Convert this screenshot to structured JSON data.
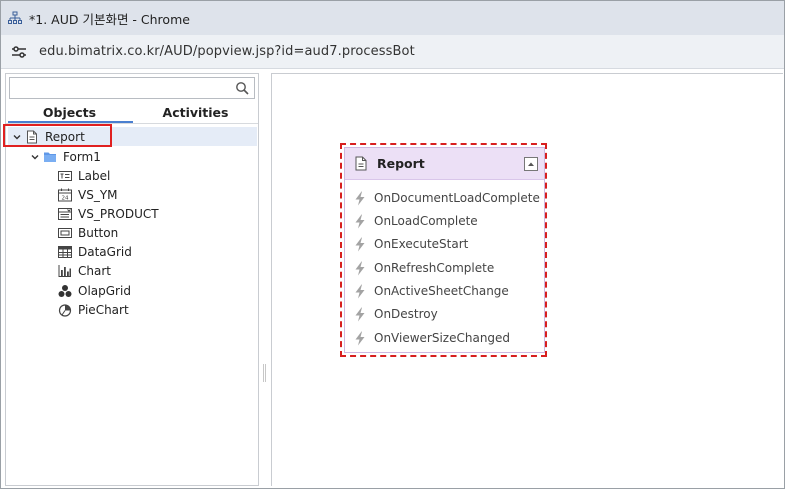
{
  "window": {
    "title": "*1. AUD 기본화면 - Chrome",
    "url": "edu.bimatrix.co.kr/AUD/popview.jsp?id=aud7.processBot"
  },
  "left_pane": {
    "search": {
      "value": "",
      "placeholder": ""
    },
    "tabs": [
      {
        "label": "Objects",
        "active": true
      },
      {
        "label": "Activities",
        "active": false
      }
    ],
    "tree": {
      "root": {
        "label": "Report",
        "icon": "document-icon",
        "expanded": true,
        "selected": true
      },
      "form": {
        "label": "Form1",
        "icon": "folder-icon",
        "expanded": true
      },
      "children": [
        {
          "label": "Label",
          "icon": "label-control-icon"
        },
        {
          "label": "VS_YM",
          "icon": "calendar-control-icon"
        },
        {
          "label": "VS_PRODUCT",
          "icon": "combo-control-icon"
        },
        {
          "label": "Button",
          "icon": "button-control-icon"
        },
        {
          "label": "DataGrid",
          "icon": "grid-control-icon"
        },
        {
          "label": "Chart",
          "icon": "bar-chart-icon"
        },
        {
          "label": "OlapGrid",
          "icon": "olap-cubes-icon"
        },
        {
          "label": "PieChart",
          "icon": "pie-chart-icon"
        }
      ]
    }
  },
  "event_panel": {
    "title": "Report",
    "icon": "document-icon",
    "collapse_icon": "chevron-up-icon",
    "events": [
      "OnDocumentLoadComplete",
      "OnLoadComplete",
      "OnExecuteStart",
      "OnRefreshComplete",
      "OnActiveSheetChange",
      "OnDestroy",
      "OnViewerSizeChanged"
    ]
  },
  "colors": {
    "accent": "#4a7fd0",
    "highlight_red": "#e02020",
    "event_header_bg": "#ece0f6",
    "selection_bg": "#e5ecf7"
  }
}
